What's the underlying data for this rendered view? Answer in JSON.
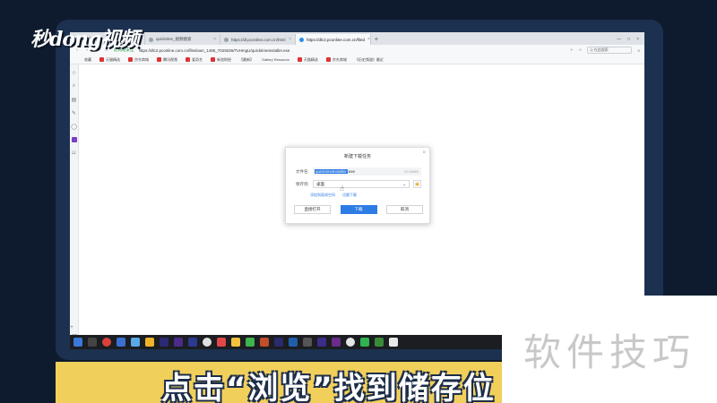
{
  "brand_logo": "秒dong视频",
  "browser": {
    "tabs": [
      {
        "title": "网址导航",
        "active": false
      },
      {
        "title": "quicktime_视频搜索",
        "active": false
      },
      {
        "title": "https://dl.pconline.com.cn/html",
        "active": false
      },
      {
        "title": "https://dlc2.pconline.com.cn/filed",
        "active": true
      }
    ],
    "address": {
      "safe_label": "此网站安全",
      "url": "https://dlc2.pconline.com.cn/filedown_1485_7025026/TvHmgU/quicktimeinstaller.exe",
      "search_label": "Q 在此搜索"
    },
    "bookmarks": [
      "收藏",
      "天猫精选",
      "京东商城",
      "腾讯视频",
      "爱奇艺",
      "新浪财经",
      "【最新】",
      "Gallery Resource",
      "天猫精选",
      "京东商城",
      "《历史频道》最近"
    ]
  },
  "dialog": {
    "title": "新建下载任务",
    "filename_label": "文件名:",
    "filename_selected": "quicktimeinstaller",
    "filename_ext": ".exe",
    "file_size": "39.65MB",
    "savepath_label": "保存到:",
    "savepath_value": "桌面",
    "link_1": "添加到离线空间",
    "link_2": "迅雷下载",
    "btn_open": "直接打开",
    "btn_download": "下载",
    "btn_cancel": "取消",
    "accent": "#2d7be5"
  },
  "caption": "点击“浏览”找到储存位",
  "watermark": "软件技巧",
  "caption_color": "#f1cf5b"
}
